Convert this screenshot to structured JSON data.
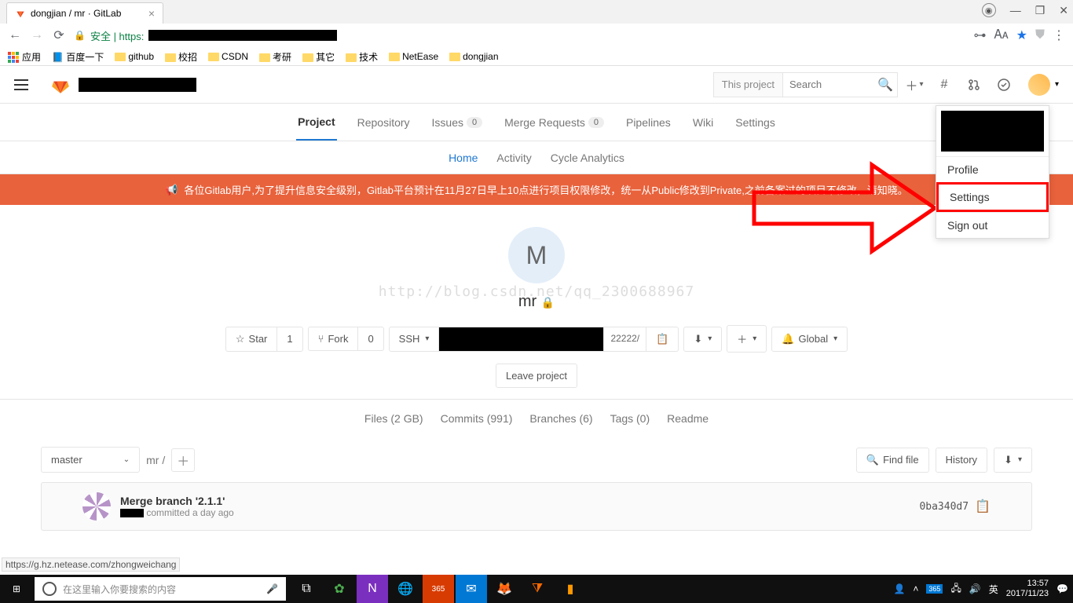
{
  "browser": {
    "tab_title": "dongjian / mr · GitLab",
    "url_prefix": "安全 | https:",
    "bookmarks": [
      "应用",
      "百度一下",
      "github",
      "校招",
      "CSDN",
      "考研",
      "其它",
      "技术",
      "NetEase",
      "dongjian"
    ]
  },
  "gitlab": {
    "search_scope": "This project",
    "search_placeholder": "Search",
    "nav": {
      "project": "Project",
      "repository": "Repository",
      "issues": "Issues",
      "issues_count": "0",
      "merge_requests": "Merge Requests",
      "mr_count": "0",
      "pipelines": "Pipelines",
      "wiki": "Wiki",
      "settings": "Settings"
    },
    "subnav": {
      "home": "Home",
      "activity": "Activity",
      "cycle": "Cycle Analytics"
    },
    "banner": "各位Gitlab用户,为了提升信息安全级别，Gitlab平台预计在11月27日早上10点进行项目权限修改，统一从Public修改到Private,之前备案过的项目不修改，请知晓。",
    "project_letter": "M",
    "project_name": "mr",
    "watermark": "http://blog.csdn.net/qq_2300688967",
    "star": "Star",
    "star_count": "1",
    "fork": "Fork",
    "fork_count": "0",
    "ssh": "SSH",
    "clone_suffix": "22222/",
    "global": "Global",
    "leave": "Leave project",
    "stats": {
      "files": "Files (2 GB)",
      "commits": "Commits (991)",
      "branches": "Branches (6)",
      "tags": "Tags (0)",
      "readme": "Readme"
    },
    "branch": "master",
    "breadcrumb": "mr /",
    "find_file": "Find file",
    "history": "History",
    "commit": {
      "title": "Merge branch '2.1.1'",
      "meta": " committed a day ago",
      "sha": "0ba340d7"
    },
    "menu": {
      "profile": "Profile",
      "settings": "Settings",
      "signout": "Sign out"
    }
  },
  "status_link": "https://g.hz.netease.com/zhongweichang",
  "taskbar": {
    "search_placeholder": "在这里输入你要搜索的内容",
    "time": "13:57",
    "date": "2017/11/23",
    "lang": "英"
  }
}
